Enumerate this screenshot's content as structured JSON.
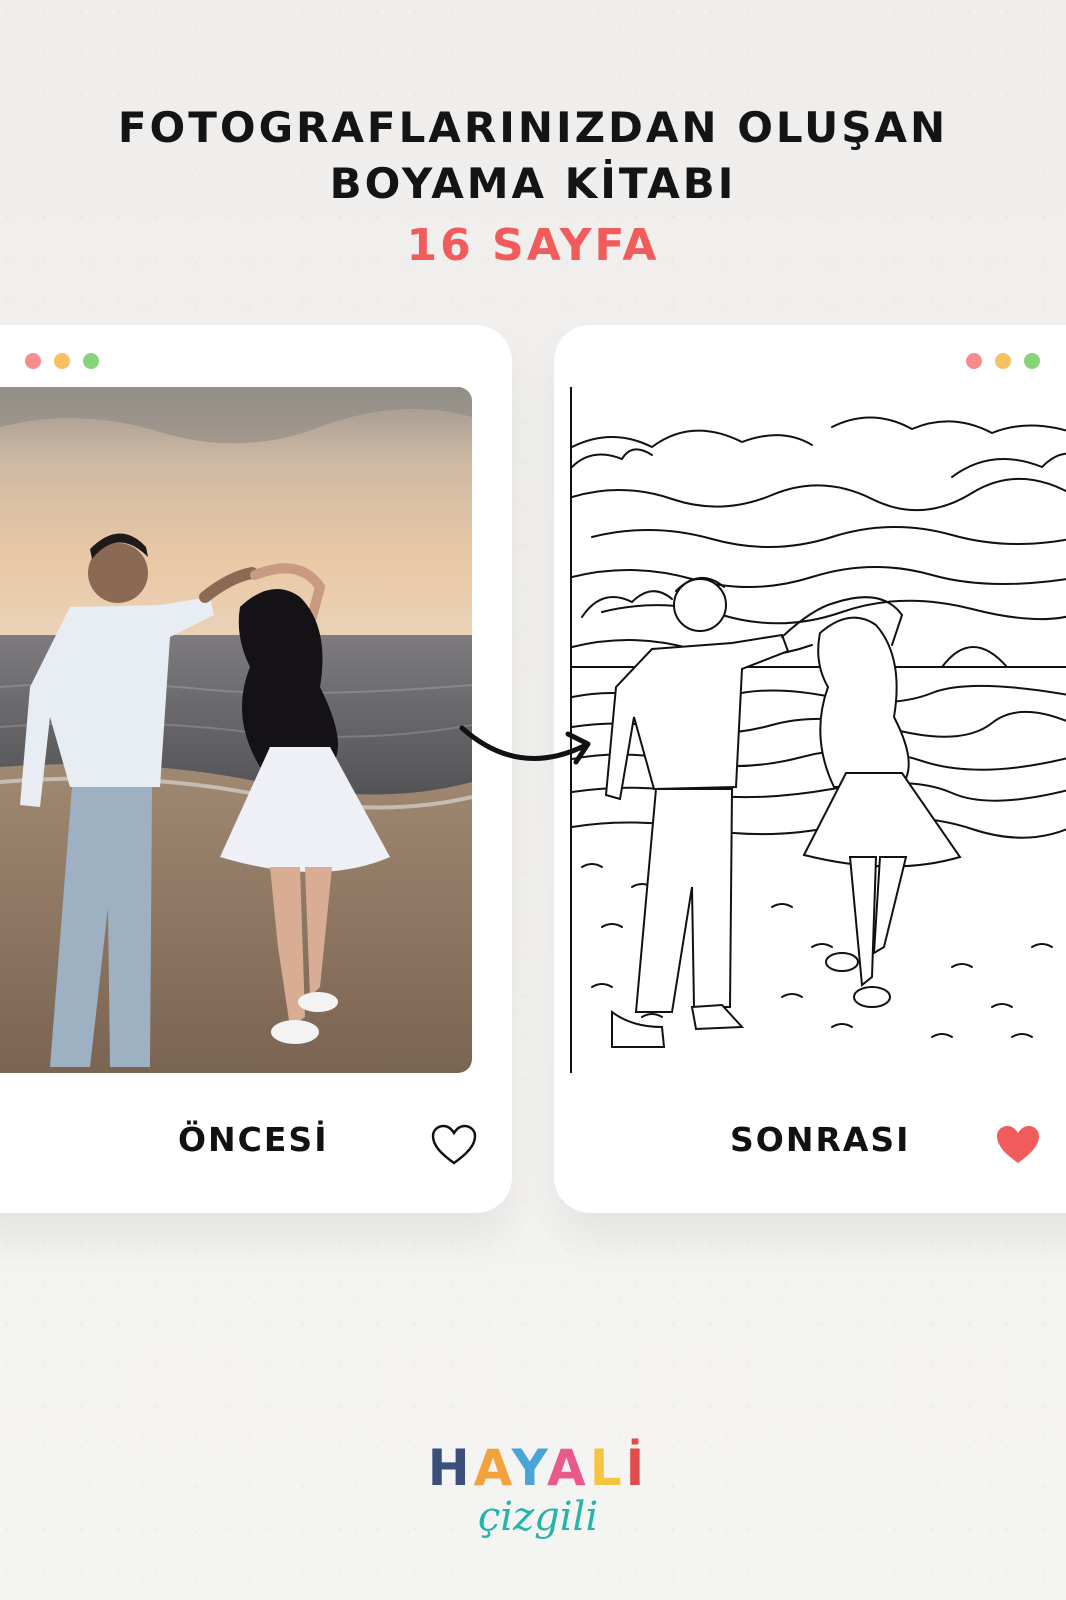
{
  "headline": {
    "line1": "FOTOGRAFLARINIZDAN OLUŞAN",
    "line2": "BOYAMA KİTABI",
    "line3": "16 SAYFA"
  },
  "colors": {
    "accent": "#f25b5b",
    "dot_red": "#f78c8c",
    "dot_yellow": "#f6c063",
    "dot_green": "#86d37a"
  },
  "cards": {
    "before": {
      "label": "ÖNCESİ",
      "heart": "heart-outline-icon"
    },
    "after": {
      "label": "SONRASI",
      "heart": "heart-filled-icon"
    }
  },
  "logo": {
    "word_letters": [
      "H",
      "A",
      "Y",
      "A",
      "L",
      "İ"
    ],
    "letter_colors": [
      "#3a4f7a",
      "#f2a23a",
      "#4aa4d8",
      "#e85a8a",
      "#f5c542",
      "#e14b4b"
    ],
    "sub": "çizgili"
  }
}
